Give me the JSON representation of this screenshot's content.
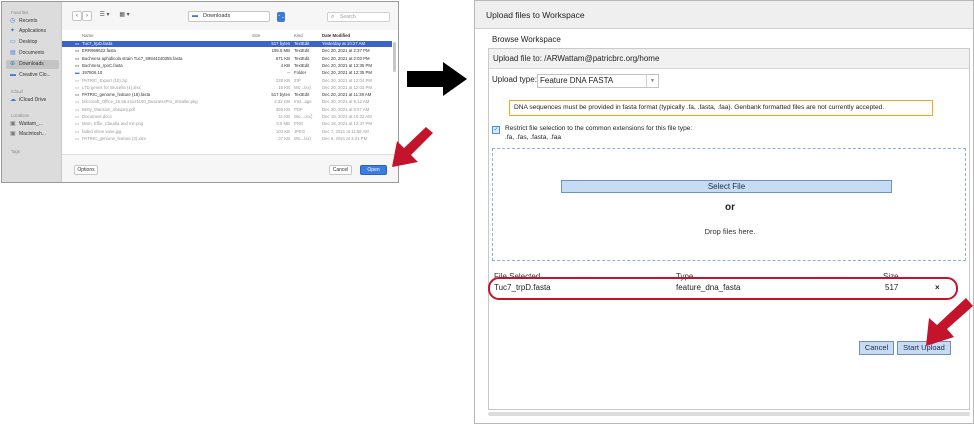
{
  "mac_dialog": {
    "sidebar": {
      "favorites_heading": "Favorites",
      "favorites": [
        {
          "label": "Recents",
          "icon": "clock-icon"
        },
        {
          "label": "Applications",
          "icon": "applications-icon"
        },
        {
          "label": "Desktop",
          "icon": "desktop-icon"
        },
        {
          "label": "Documents",
          "icon": "document-icon"
        },
        {
          "label": "Downloads",
          "icon": "download-icon"
        },
        {
          "label": "Creative Clo...",
          "icon": "folder-icon"
        }
      ],
      "icloud_heading": "iCloud",
      "icloud": [
        {
          "label": "iCloud Drive",
          "icon": "cloud-icon"
        }
      ],
      "locations_heading": "Locations",
      "locations": [
        {
          "label": "Wattam_...",
          "icon": "disk-icon"
        },
        {
          "label": "Macintosh...",
          "icon": "disk-icon"
        }
      ],
      "tags_heading": "Tags"
    },
    "toolbar": {
      "back_label": "‹",
      "forward_label": "›",
      "list_view_label": "☰ ▾",
      "grid_view_label": "▦ ▾",
      "location": "Downloads",
      "location_arrow": "⌃⌄",
      "search_placeholder": "Search"
    },
    "columns": {
      "name": "Name",
      "size": "Size",
      "kind": "Kind",
      "date": "Date Modified"
    },
    "files": [
      {
        "name": "Tuc7_trpD.fasta",
        "size": "517 bytes",
        "kind": "TextEdit",
        "date": "Yesterday at 10:27 AM",
        "state": "selected",
        "icon": "file-icon"
      },
      {
        "name": "ERR969622.fasta",
        "size": "195.5 MB",
        "kind": "TextEdit",
        "date": "Dec 20, 2021 at 2:37 PM",
        "state": "normal",
        "icon": "file-icon"
      },
      {
        "name": "Buchnera aphidicola strain Tuc7_59844240355.fasta",
        "size": "671 KB",
        "kind": "TextEdit",
        "date": "Dec 20, 2021 at 2:03 PM",
        "state": "normal",
        "icon": "file-icon"
      },
      {
        "name": "Buchnera_rpoC.fasta",
        "size": "4 KB",
        "kind": "TextEdit",
        "date": "Dec 20, 2021 at 12:35 PM",
        "state": "normal",
        "icon": "file-icon"
      },
      {
        "name": "197806.10",
        "size": "--",
        "kind": "Folder",
        "date": "Dec 20, 2021 at 12:35 PM",
        "state": "normal",
        "icon": "folder-icon"
      },
      {
        "name": "PATRIC_Export (10).zip",
        "size": "228 KB",
        "kind": "ZIP",
        "date": "Dec 20, 2021 at 12:04 PM",
        "state": "dim",
        "icon": "file-icon"
      },
      {
        "name": "LTD genes for Brucella (4).xlsx",
        "size": "16 KB",
        "kind": "Mic...lsx)",
        "date": "Dec 20, 2021 at 12:03 PM",
        "state": "dim",
        "icon": "file-icon"
      },
      {
        "name": "PATRIC_genome_feature (18).fasta",
        "size": "517 bytes",
        "kind": "TextEdit",
        "date": "Dec 20, 2021 at 11:39 AM",
        "state": "normal",
        "icon": "file-icon"
      },
      {
        "name": "Microsoft_Office_16.56.21121100_BusinessPro_Installer.pkg",
        "size": "2.32 GB",
        "kind": "Inst...age",
        "date": "Dec 20, 2021 at 9:12 AM",
        "state": "dim",
        "icon": "file-icon"
      },
      {
        "name": "Betty_Mansion_obituary.pdf",
        "size": "359 KB",
        "kind": "PDF",
        "date": "Dec 20, 2021 at 8:57 AM",
        "state": "dim",
        "icon": "file-icon"
      },
      {
        "name": "Document.docx",
        "size": "11 KB",
        "kind": "Mic...ocx)",
        "date": "Dec 19, 2021 at 10:32 AM",
        "state": "dim",
        "icon": "file-icon"
      },
      {
        "name": "Mom, Effie, Claudia and me.png",
        "size": "6.5 MB",
        "kind": "PNG",
        "date": "Dec 18, 2021 at 12:37 PM",
        "state": "dim",
        "icon": "file-icon"
      },
      {
        "name": "faded shine vase.jpg",
        "size": "103 KB",
        "kind": "JPEG",
        "date": "Dec 7, 2021 at 11:58 AM",
        "state": "dim",
        "icon": "file-icon"
      },
      {
        "name": "PATRIC_genome_feature (3).xlsx",
        "size": "37 KB",
        "kind": "Mic...lsx)",
        "date": "Dec 6, 2021 at 3:31 PM",
        "state": "dim",
        "icon": "file-icon"
      }
    ],
    "footer": {
      "options_label": "Options",
      "cancel_label": "Cancel",
      "open_label": "Open"
    }
  },
  "upload_dialog": {
    "title": "Upload files to Workspace",
    "browse_label": "Browse Workspace",
    "upload_to": "Upload file to: /ARWattam@patricbrc.org/home",
    "upload_type_label": "Upload type:",
    "upload_type_value": "Feature DNA FASTA",
    "warning": "DNA sequences must be provided in fasta format (typically .fa, .fasta, .faa). Genbank formatted files are not currently accepted.",
    "restrict_checked": true,
    "restrict_label": "Restrict file selection to the common extensions for this file type:",
    "restrict_extensions": ".fa, .fas, .fasta, .faa",
    "select_file_label": "Select File",
    "or_label": "or",
    "drop_label": "Drop files here.",
    "table_headers": {
      "file": "File Selected",
      "type": "Type",
      "size": "Size"
    },
    "selected_file": {
      "name": "Tuc7_trpD.fasta",
      "type": "feature_dna_fasta",
      "size": "517",
      "remove": "×"
    },
    "cancel_label": "Cancel",
    "start_upload_label": "Start Upload"
  },
  "colors": {
    "annotation_red": "#c4142b",
    "arrow_black": "#000000",
    "accent_blue": "#3b63c9"
  }
}
